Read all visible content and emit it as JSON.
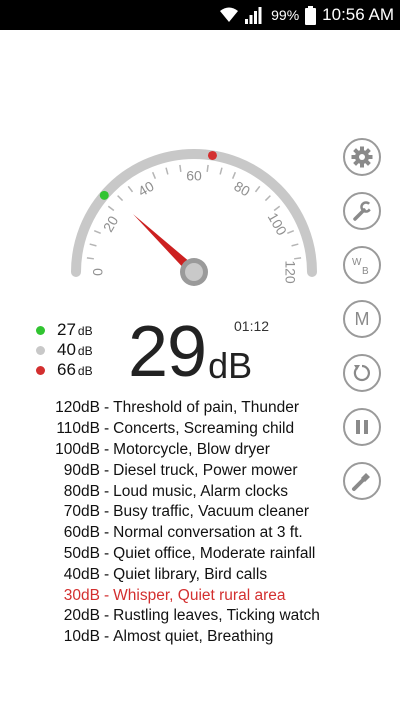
{
  "status_bar": {
    "battery_percent": "99%",
    "time": "10:56 AM"
  },
  "gauge": {
    "ticks": [
      "0",
      "20",
      "40",
      "60",
      "80",
      "100",
      "120"
    ],
    "min": 0,
    "max": 120,
    "needle_value": 29,
    "green_marker_value": 27,
    "red_marker_value": 66,
    "colors": {
      "needle": "#cc2020",
      "green": "#31c431",
      "red": "#d32f2f",
      "grey": "#c8c8c8"
    }
  },
  "stats": {
    "items": [
      {
        "value": "27",
        "unit": "dB",
        "color": "#31c431"
      },
      {
        "value": "40",
        "unit": "dB",
        "color": "#c8c8c8"
      },
      {
        "value": "66",
        "unit": "dB",
        "color": "#d32f2f"
      }
    ]
  },
  "reading": {
    "value": "29",
    "unit": "dB",
    "elapsed": "01:12"
  },
  "side_buttons": {
    "items": [
      {
        "name": "settings-button",
        "icon": "gear-icon"
      },
      {
        "name": "calibrate-button",
        "icon": "wrench-icon"
      },
      {
        "name": "weighting-button",
        "label": "WB"
      },
      {
        "name": "mode-button",
        "label": "M"
      },
      {
        "name": "reset-button",
        "icon": "refresh-icon"
      },
      {
        "name": "pause-button",
        "icon": "pause-icon"
      },
      {
        "name": "flashlight-button",
        "icon": "flashlight-icon"
      }
    ]
  },
  "reference": {
    "highlight_index": 9,
    "highlight_color": "#d32f2f",
    "rows": [
      {
        "db": "120dB",
        "text": "Threshold of pain, Thunder"
      },
      {
        "db": "110dB",
        "text": "Concerts, Screaming child"
      },
      {
        "db": "100dB",
        "text": "Motorcycle, Blow dryer"
      },
      {
        "db": "90dB",
        "text": "Diesel truck, Power mower"
      },
      {
        "db": "80dB",
        "text": "Loud music, Alarm clocks"
      },
      {
        "db": "70dB",
        "text": "Busy traffic, Vacuum cleaner"
      },
      {
        "db": "60dB",
        "text": "Normal conversation at 3 ft."
      },
      {
        "db": "50dB",
        "text": "Quiet office, Moderate rainfall"
      },
      {
        "db": "40dB",
        "text": "Quiet library, Bird calls"
      },
      {
        "db": "30dB",
        "text": "Whisper, Quiet rural area"
      },
      {
        "db": "20dB",
        "text": "Rustling leaves, Ticking watch"
      },
      {
        "db": "10dB",
        "text": "Almost quiet, Breathing"
      }
    ],
    "separator": "-"
  }
}
